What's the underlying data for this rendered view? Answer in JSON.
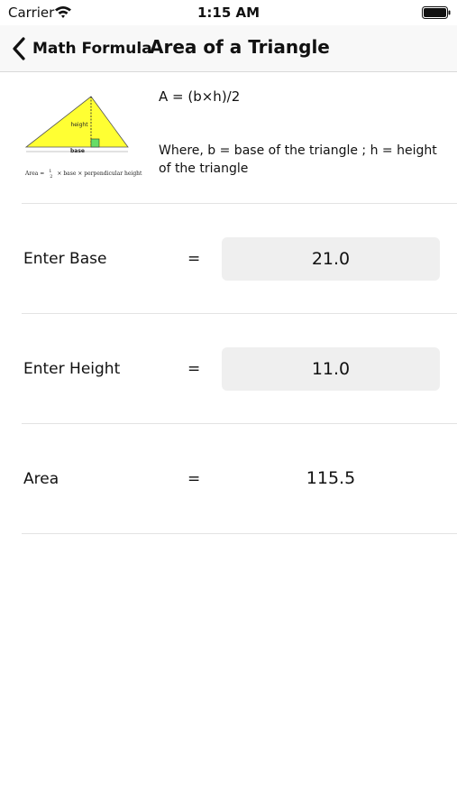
{
  "status_bar": {
    "carrier": "Carrier",
    "time": "1:15 AM",
    "icons": [
      "wifi-icon",
      "battery-icon"
    ]
  },
  "nav": {
    "back_label": "Math Formula",
    "back_icon": "chevron-left-icon",
    "title": "Area of a Triangle"
  },
  "diagram": {
    "height_label": "height",
    "base_label": "base",
    "caption_prefix": "Area =",
    "caption_fraction_num": "1",
    "caption_fraction_den": "2",
    "caption_suffix": "× base × perpendicular height",
    "triangle_fill": "#ffff33"
  },
  "formula": {
    "expression": "A = (b×h)/2",
    "description": "Where, b = base of the triangle ; h = height of the triangle"
  },
  "rows": [
    {
      "label": "Enter Base",
      "equals": "=",
      "value": "21.0"
    },
    {
      "label": "Enter Height",
      "equals": "=",
      "value": "11.0"
    },
    {
      "label": "Area",
      "equals": "=",
      "value": "115.5"
    }
  ]
}
